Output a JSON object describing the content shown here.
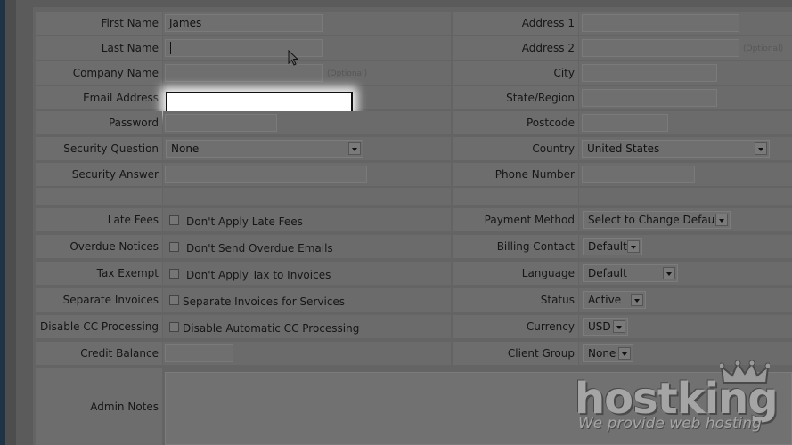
{
  "left_labels": {
    "first_name": "First Name",
    "last_name": "Last Name",
    "company_name": "Company Name",
    "email": "Email Address",
    "password": "Password",
    "security_question": "Security Question",
    "security_answer": "Security Answer",
    "late_fees": "Late Fees",
    "overdue_notices": "Overdue Notices",
    "tax_exempt": "Tax Exempt",
    "separate_invoices": "Separate Invoices",
    "disable_cc": "Disable CC Processing",
    "credit_balance": "Credit Balance",
    "admin_notes": "Admin Notes"
  },
  "right_labels": {
    "address1": "Address 1",
    "address2": "Address 2",
    "city": "City",
    "state": "State/Region",
    "postcode": "Postcode",
    "country": "Country",
    "phone": "Phone Number",
    "payment_method": "Payment Method",
    "billing_contact": "Billing Contact",
    "language": "Language",
    "status": "Status",
    "currency": "Currency",
    "client_group": "Client Group"
  },
  "values": {
    "first_name": "James",
    "last_name": "",
    "company_name": "",
    "email": "",
    "security_question": "None",
    "country": "United States",
    "payment_method": "Select to Change Default",
    "billing_contact": "Default",
    "language": "Default",
    "status": "Active",
    "currency": "USD",
    "client_group": "None"
  },
  "optional_text": "(Optional)",
  "checkboxes": {
    "late_fees": "Don't Apply Late Fees",
    "overdue_notices": "Don't Send Overdue Emails",
    "tax_exempt": "Don't Apply Tax to Invoices",
    "separate_invoices": "Separate Invoices for Services",
    "disable_cc": "Disable Automatic CC Processing"
  },
  "logo": {
    "name": "hostking",
    "tagline": "We provide web hosting"
  },
  "colors": {
    "accent_bar": "#1f3346",
    "focus": "#ffffff"
  }
}
